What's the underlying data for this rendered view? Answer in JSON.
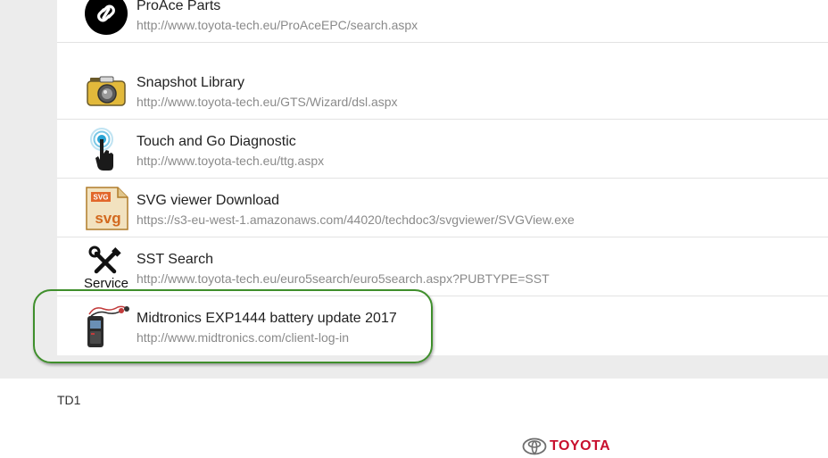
{
  "links": [
    {
      "title": "ProAce Parts",
      "url": "http://www.toyota-tech.eu/ProAceEPC/search.aspx",
      "icon": "link-icon"
    },
    {
      "title": "Snapshot Library",
      "url": "http://www.toyota-tech.eu/GTS/Wizard/dsl.aspx",
      "icon": "camera-icon"
    },
    {
      "title": "Touch and Go Diagnostic",
      "url": "http://www.toyota-tech.eu/ttg.aspx",
      "icon": "touch-hand-icon"
    },
    {
      "title": "SVG viewer Download",
      "url": "https://s3-eu-west-1.amazonaws.com/44020/techdoc3/svgviewer/SVGView.exe",
      "icon": "svg-file-icon",
      "icon_text": [
        "SVG",
        "svg"
      ]
    },
    {
      "title": "SST Search",
      "url": "http://www.toyota-tech.eu/euro5search/euro5search.aspx?PUBTYPE=SST",
      "icon": "service-tools-icon",
      "icon_text": "Service"
    },
    {
      "title": "Midtronics EXP1444 battery update 2017",
      "url": "http://www.midtronics.com/client-log-in",
      "icon": "battery-tester-icon"
    }
  ],
  "highlight_color": "#3f8f2c",
  "footer": {
    "code": "TD1",
    "brand": "TOYOTA"
  },
  "brand_color": "#c8102e"
}
